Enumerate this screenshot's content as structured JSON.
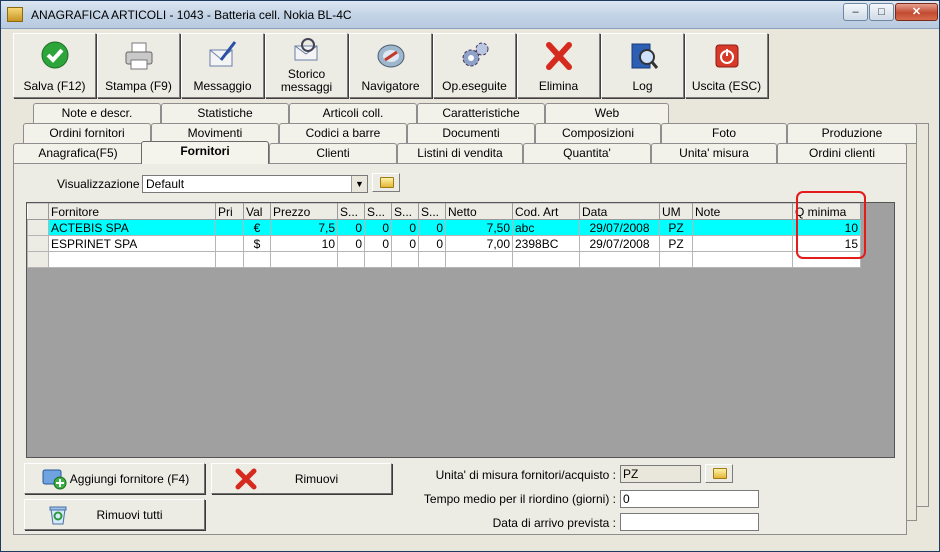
{
  "window": {
    "title": "ANAGRAFICA ARTICOLI - 1043 - Batteria cell. Nokia BL-4C"
  },
  "toolbar": [
    {
      "label": "Salva (F12)",
      "icon": "check-icon"
    },
    {
      "label": "Stampa (F9)",
      "icon": "printer-icon"
    },
    {
      "label": "Messaggio",
      "icon": "envelope-pen-icon"
    },
    {
      "label": "Storico messaggi",
      "icon": "envelope-search-icon"
    },
    {
      "label": "Navigatore",
      "icon": "compass-icon"
    },
    {
      "label": "Op.eseguite",
      "icon": "gears-icon"
    },
    {
      "label": "Elimina",
      "icon": "red-x-icon"
    },
    {
      "label": "Log",
      "icon": "book-search-icon"
    },
    {
      "label": "Uscita (ESC)",
      "icon": "power-icon"
    }
  ],
  "tabs": {
    "row1": [
      "Note e descr.",
      "Statistiche",
      "Articoli coll.",
      "Caratteristiche",
      "Web"
    ],
    "row2": [
      "Ordini fornitori",
      "Movimenti",
      "Codici a barre",
      "Documenti",
      "Composizioni",
      "Foto",
      "Produzione"
    ],
    "row3": [
      "Anagrafica(F5)",
      "Fornitori",
      "Clienti",
      "Listini di vendita",
      "Quantita'",
      "Unita' misura",
      "Ordini clienti"
    ],
    "active": "Fornitori"
  },
  "visualizzazione": {
    "label": "Visualizzazione :",
    "value": "Default"
  },
  "grid": {
    "columns": [
      "",
      "Fornitore",
      "Pri",
      "Val",
      "Prezzo",
      "S...",
      "S...",
      "S...",
      "S...",
      "Netto",
      "Cod. Art",
      "Data",
      "UM",
      "Note",
      "Q minima"
    ],
    "rows": [
      [
        "",
        "ACTEBIS SPA",
        "",
        "€",
        "7,5",
        "0",
        "0",
        "0",
        "0",
        "7,50",
        "abc",
        "29/07/2008",
        "PZ",
        "",
        "10"
      ],
      [
        "",
        "ESPRINET SPA",
        "",
        "$",
        "10",
        "0",
        "0",
        "0",
        "0",
        "7,00",
        "2398BC",
        "29/07/2008",
        "PZ",
        "",
        "15"
      ],
      [
        "",
        "",
        "",
        "",
        "",
        "",
        "",
        "",
        "",
        "",
        "",
        "",
        "",
        "",
        ""
      ]
    ],
    "selected_row": 0
  },
  "buttons": {
    "add": "Aggiungi fornitore (F4)",
    "remove": "Rimuovi",
    "remove_all": "Rimuovi tutti"
  },
  "form": {
    "unita_label": "Unita' di misura fornitori/acquisto :",
    "unita_value": "PZ",
    "tempo_label": "Tempo medio per il riordino (giorni) :",
    "tempo_value": "0",
    "data_label": "Data di arrivo prevista :",
    "data_value": ""
  },
  "colors": {
    "selected_row": "#00ffff",
    "highlight_box": "#e31b1b"
  }
}
